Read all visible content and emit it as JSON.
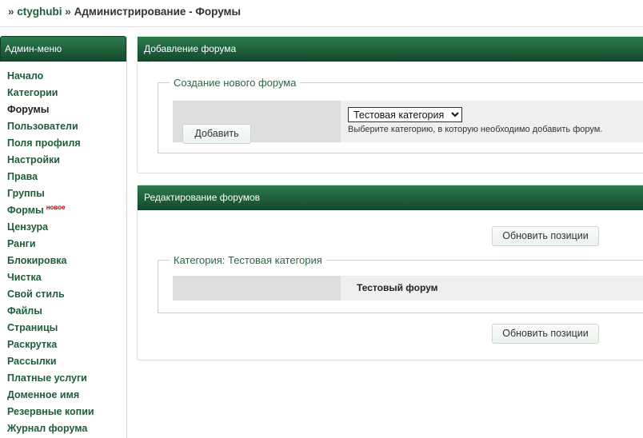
{
  "breadcrumb": {
    "sep1": "»",
    "site": "ctyghubi",
    "sep2": "»",
    "rest": "Администрирование - Форумы"
  },
  "sidebar": {
    "title": "Админ-меню",
    "items": [
      {
        "label": "Начало"
      },
      {
        "label": "Категории"
      },
      {
        "label": "Форумы"
      },
      {
        "label": "Пользователи"
      },
      {
        "label": "Поля профиля"
      },
      {
        "label": "Настройки"
      },
      {
        "label": "Права"
      },
      {
        "label": "Группы"
      },
      {
        "label": "Формы",
        "badge": "новое"
      },
      {
        "label": "Цензура"
      },
      {
        "label": "Ранги"
      },
      {
        "label": "Блокировка"
      },
      {
        "label": "Чистка"
      },
      {
        "label": "Свой стиль"
      },
      {
        "label": "Файлы"
      },
      {
        "label": "Страницы"
      },
      {
        "label": "Раскрутка"
      },
      {
        "label": "Рассылки"
      },
      {
        "label": "Платные услуги"
      },
      {
        "label": "Доменное имя"
      },
      {
        "label": "Резервные копии"
      },
      {
        "label": "Журнал форума"
      }
    ]
  },
  "add_panel": {
    "title": "Добавление форума",
    "legend": "Создание нового форума",
    "add_button": "Добавить",
    "category_selected": "Тестовая категория",
    "hint": "Выберите категорию, в которую необходимо добавить форум."
  },
  "edit_panel": {
    "title": "Редактирование форумов",
    "update_button_top": "Обновить позиции",
    "legend": "Категория: Тестовая категория",
    "forum_name": "Тестовый форум",
    "update_button_bottom": "Обновить позиции"
  }
}
